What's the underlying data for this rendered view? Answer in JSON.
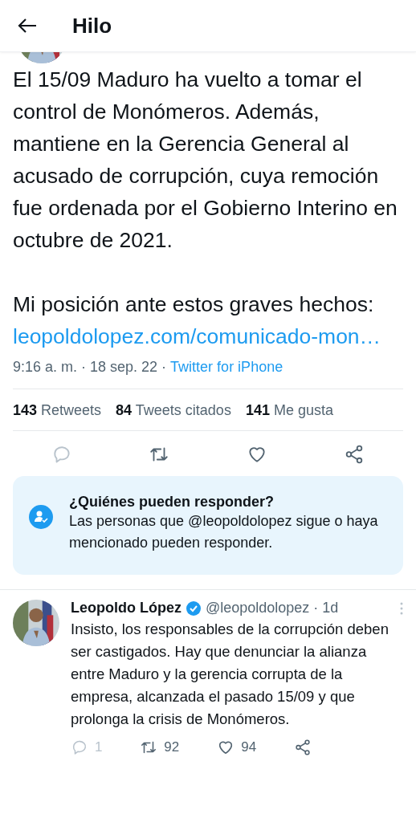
{
  "header": {
    "title": "Hilo"
  },
  "tweet": {
    "paragraphs": [
      "El 15/09 Maduro ha vuelto a tomar el control de Monómeros. Además, mantiene en la Gerencia General al acusado de corrupción, cuya remoción fue ordenada por el Gobierno Interino en octubre de 2021.",
      "Mi posición ante estos graves hechos:"
    ],
    "link": "leopoldolopez.com/comunicado-mon…",
    "time": "9:16 a. m. · 18 sep. 22 ·",
    "source": "Twitter for iPhone",
    "stats": [
      {
        "count": "143",
        "label": "Retweets"
      },
      {
        "count": "84",
        "label": "Tweets citados"
      },
      {
        "count": "141",
        "label": "Me gusta"
      }
    ]
  },
  "reply_notice": {
    "title": "¿Quiénes pueden responder?",
    "text": "Las personas que @leopoldolopez sigue o haya mencionado pueden responder."
  },
  "reply": {
    "name": "Leopoldo López",
    "verified": true,
    "handle": "@leopoldolopez · 1d",
    "text": "Insisto, los responsables de la corrupción deben ser castigados. Hay que denunciar la alianza entre Maduro y la gerencia corrupta de la empresa, alcanzada el pasado 15/09 y que prolonga la crisis de Monómeros.",
    "actions": [
      {
        "kind": "reply",
        "count": "1"
      },
      {
        "kind": "retweet",
        "count": "92"
      },
      {
        "kind": "like",
        "count": "94"
      },
      {
        "kind": "share"
      }
    ]
  }
}
